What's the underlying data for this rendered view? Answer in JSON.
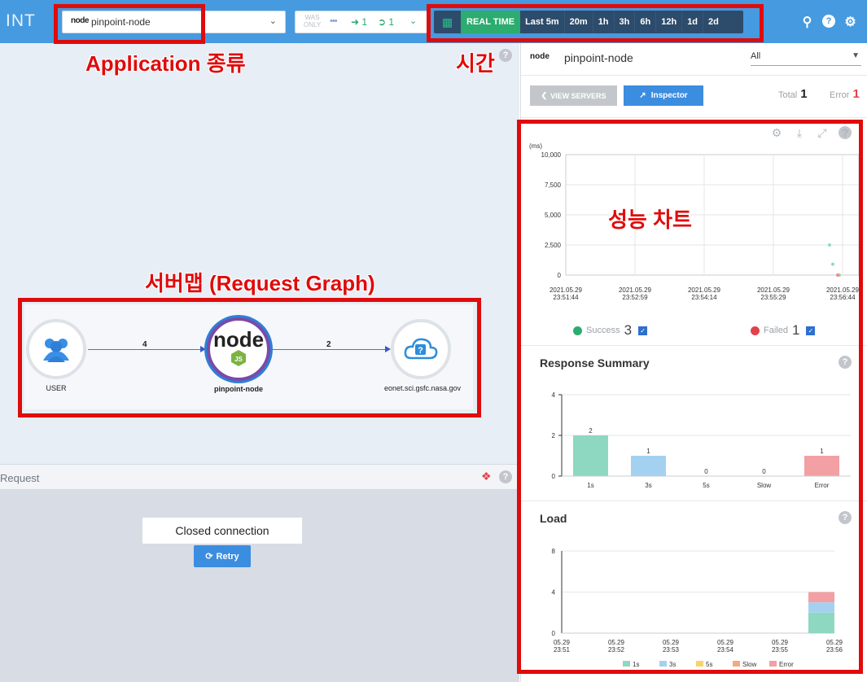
{
  "header": {
    "brand": "INT",
    "app_select": {
      "logo": "node",
      "value": "pinpoint-node"
    },
    "was_only": "WAS\nONLY",
    "inbound_count": "1",
    "outbound_count": "1",
    "time": {
      "realtime": "REAL TIME",
      "options": [
        "Last 5m",
        "20m",
        "1h",
        "3h",
        "6h",
        "12h",
        "1d",
        "2d"
      ]
    }
  },
  "server_map": {
    "nodes": [
      {
        "id": "user",
        "label": "USER",
        "icon": "users-icon"
      },
      {
        "id": "app",
        "label": "pinpoint-node",
        "icon": "nodejs-icon"
      },
      {
        "id": "ext",
        "label": "eonet.sci.gsfc.nasa.gov",
        "icon": "cloud-question-icon"
      }
    ],
    "edges": [
      {
        "from": "user",
        "to": "app",
        "count": "4"
      },
      {
        "from": "app",
        "to": "ext",
        "count": "2"
      }
    ]
  },
  "request_panel": {
    "title": "Request",
    "status": "Closed connection",
    "retry_label": "Retry"
  },
  "right_panel": {
    "app_logo": "node",
    "app_name": "pinpoint-node",
    "agent_filter": "All",
    "view_servers_label": "VIEW SERVERS",
    "inspector_label": "Inspector",
    "total_label": "Total",
    "total_value": "1",
    "error_label": "Error",
    "error_value": "1",
    "success_label": "Success",
    "success_value": "3",
    "failed_label": "Failed",
    "failed_value": "1",
    "response_summary_title": "Response Summary",
    "load_title": "Load"
  },
  "annotations": {
    "application": "Application 종류",
    "time": "시간",
    "chart": "성능 차트",
    "server_map": "서버맵 (Request Graph)"
  },
  "colors": {
    "top_bar": "#469ae0",
    "realtime": "#2cac6f",
    "success": "#2cac6f",
    "failed": "#e0434b",
    "annotation": "#e00b0b",
    "bar_1s": "#8ed8c2",
    "bar_3s": "#a4d1f0",
    "bar_5s": "#f7d36e",
    "bar_slow": "#f5a97f",
    "bar_error": "#f2a0a3"
  },
  "chart_data": [
    {
      "type": "scatter",
      "title": "",
      "ylabel": "(ms)",
      "yticks": [
        "10,000",
        "7,500",
        "5,000",
        "2,500",
        "0"
      ],
      "ylim": [
        0,
        10000
      ],
      "xticks": [
        "2021.05.29\n23:51:44",
        "2021.05.29\n23:52:59",
        "2021.05.29\n23:54:14",
        "2021.05.29\n23:55:29",
        "2021.05.29\n23:56:44"
      ],
      "series": [
        {
          "name": "Success",
          "points": [
            {
              "x": "23:56:40",
              "y": 2500
            },
            {
              "x": "23:56:41",
              "y": 900
            },
            {
              "x": "23:56:43",
              "y": 0
            }
          ]
        },
        {
          "name": "Failed",
          "points": [
            {
              "x": "23:56:41",
              "y": 0
            }
          ]
        }
      ]
    },
    {
      "type": "bar",
      "title": "Response Summary",
      "categories": [
        "1s",
        "3s",
        "5s",
        "Slow",
        "Error"
      ],
      "values": [
        2,
        1,
        0,
        0,
        1
      ],
      "ylim": [
        0,
        4
      ],
      "yticks": [
        "4",
        "2",
        "0"
      ]
    },
    {
      "type": "bar",
      "title": "Load",
      "stacked": true,
      "categories": [
        "05.29\n23:51",
        "05.29\n23:52",
        "05.29\n23:53",
        "05.29\n23:54",
        "05.29\n23:55",
        "05.29\n23:56"
      ],
      "ylim": [
        0,
        8
      ],
      "yticks": [
        "8",
        "4",
        "0"
      ],
      "series": [
        {
          "name": "1s",
          "values": [
            0,
            0,
            0,
            0,
            0,
            2
          ]
        },
        {
          "name": "3s",
          "values": [
            0,
            0,
            0,
            0,
            0,
            1
          ]
        },
        {
          "name": "5s",
          "values": [
            0,
            0,
            0,
            0,
            0,
            0
          ]
        },
        {
          "name": "Slow",
          "values": [
            0,
            0,
            0,
            0,
            0,
            0
          ]
        },
        {
          "name": "Error",
          "values": [
            0,
            0,
            0,
            0,
            0,
            1
          ]
        }
      ]
    }
  ]
}
